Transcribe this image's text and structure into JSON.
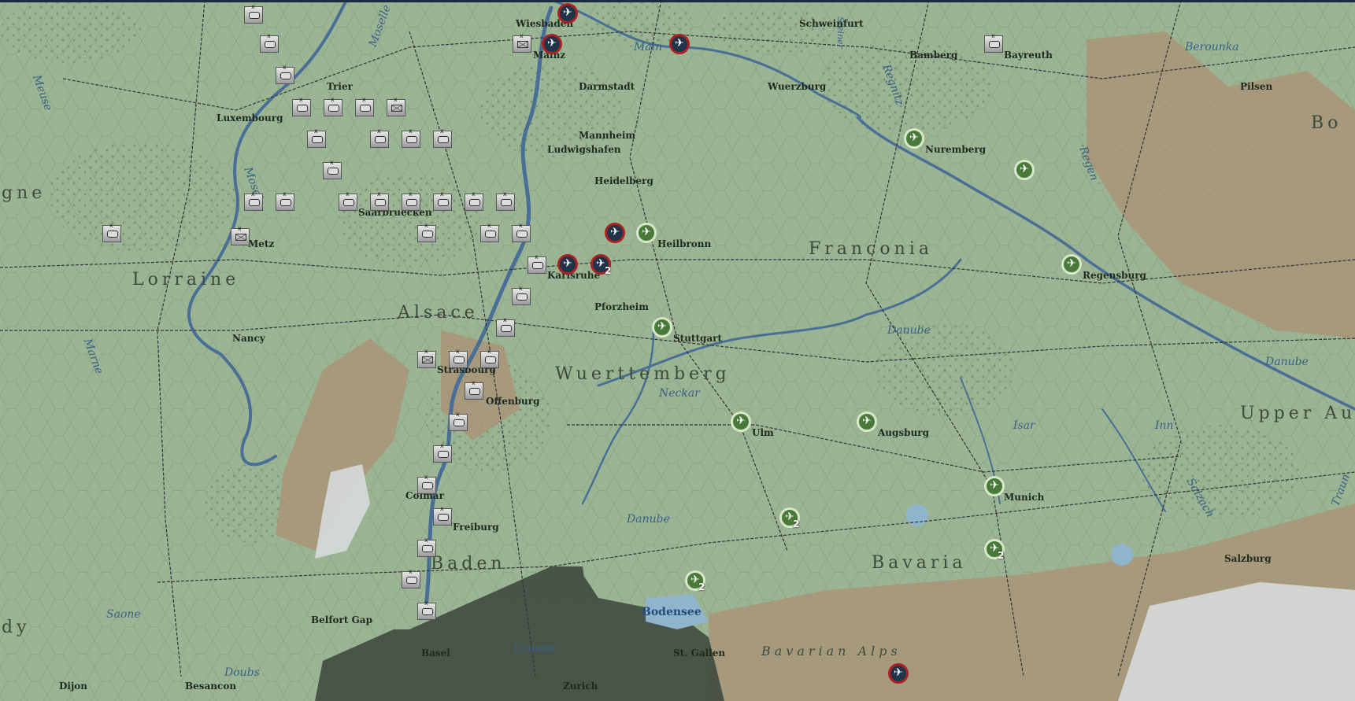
{
  "map": {
    "regions": [
      "Lorraine",
      "Alsace",
      "Wuerttemberg",
      "Franconia",
      "Bavaria",
      "Baden",
      "Upper Au",
      "Bo",
      "gne",
      "dy"
    ],
    "rivers": [
      "Meuse",
      "Moselle",
      "Mosel",
      "Main",
      "Marne",
      "Regnitz",
      "Regen",
      "Danube",
      "Neckar",
      "Isar",
      "Inn",
      "Saone",
      "Doubs",
      "Limmat",
      "Salzach",
      "Traun",
      "Berounka",
      "Steiner"
    ],
    "terrain_labels": [
      "Bodensee",
      "Bavarian Alps"
    ],
    "cities": [
      "Wiesbaden",
      "Mainz",
      "Schweinfurt",
      "Bamberg",
      "Bayreuth",
      "Trier",
      "Darmstadt",
      "Wuerzburg",
      "Pilsen",
      "Luxembourg",
      "Mannheim",
      "Ludwigshafen",
      "Nuremberg",
      "Heidelberg",
      "Saarbruecken",
      "Metz",
      "Heilbronn",
      "Karlsruhe",
      "Regensburg",
      "Pforzheim",
      "Nancy",
      "Stuttgart",
      "Strasbourg",
      "Offenburg",
      "Ulm",
      "Augsburg",
      "Munich",
      "Colmar",
      "Freiburg",
      "Salzburg",
      "Belfort Gap",
      "Basel",
      "St. Gallen",
      "Zurich",
      "Dijon",
      "Besancon"
    ],
    "stack_counts": [
      "2",
      "2",
      "2",
      "2"
    ]
  },
  "colors": {
    "map_base": "#9bb594",
    "axis_ring": "#a22",
    "axis_fill": "#223248",
    "allied_fill": "#4a7a3a",
    "river": "#4a6f96",
    "rail": "#333333"
  },
  "icons": {
    "unit": "armor-counter-icon",
    "hq": "hq-counter-icon",
    "air_axis": "axis-air-unit-icon",
    "air_allied": "allied-air-unit-icon"
  }
}
